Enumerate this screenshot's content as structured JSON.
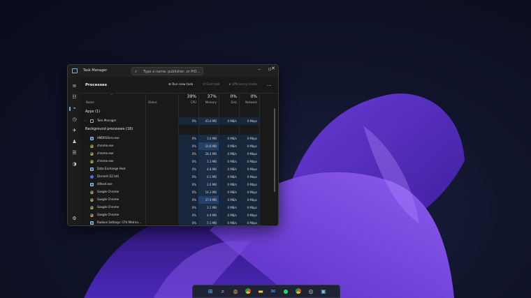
{
  "window": {
    "title": "Task Manager",
    "search_placeholder": "Type a name, publisher, or PID..."
  },
  "sidebar": {
    "items": [
      "hamburger-icon",
      "processes-icon",
      "performance-icon",
      "app-history-icon",
      "startup-icon",
      "users-icon",
      "details-icon",
      "services-icon",
      "settings-icon"
    ]
  },
  "toolbar": {
    "page_title": "Processes",
    "run_new_task": "Run new task",
    "end_task": "End task",
    "efficiency_mode": "Efficiency mode",
    "more": "..."
  },
  "columns": {
    "name": "Name",
    "status": "Status",
    "cpu_pct": "39%",
    "cpu": "CPU",
    "mem_pct": "37%",
    "mem": "Memory",
    "disk_pct": "0%",
    "disk": "Disk",
    "net_pct": "0%",
    "net": "Network"
  },
  "groups": {
    "apps": "Apps (1)",
    "background": "Background processes (18)"
  },
  "apps": [
    {
      "name": "Task Manager",
      "icon": "task-manager-icon",
      "cpu": "0%",
      "mem": "43.4 MB",
      "disk": "0 MB/s",
      "net": "0 Mbps"
    }
  ],
  "background": [
    {
      "name": "AMDRSServ.exe",
      "icon": "app",
      "cpu": "0%",
      "mem": "3.6 MB",
      "disk": "0 MB/s",
      "net": "0 Mbps"
    },
    {
      "name": "chrome.exe",
      "icon": "chrome",
      "cpu": "0%",
      "mem": "10.8 MB",
      "disk": "0 MB/s",
      "net": "0 Mbps"
    },
    {
      "name": "chrome.exe",
      "icon": "chrome",
      "cpu": "0%",
      "mem": "28.4 MB",
      "disk": "0 MB/s",
      "net": "0 Mbps"
    },
    {
      "name": "chrome.exe",
      "icon": "chrome",
      "cpu": "0%",
      "mem": "1.3 MB",
      "disk": "0 MB/s",
      "net": "0 Mbps"
    },
    {
      "name": "Data Exchange Host",
      "icon": "app",
      "cpu": "0%",
      "mem": "4.8 MB",
      "disk": "0 MB/s",
      "net": "0 Mbps"
    },
    {
      "name": "Discord (32 bit)",
      "icon": "discord",
      "cpu": "0%",
      "mem": "0.5 MB",
      "disk": "0 MB/s",
      "net": "0 Mbps"
    },
    {
      "name": "dllhost.exe",
      "icon": "app",
      "cpu": "0%",
      "mem": "2.6 MB",
      "disk": "0 MB/s",
      "net": "0 Mbps"
    },
    {
      "name": "Google Chrome",
      "icon": "chrome",
      "cpu": "0%",
      "mem": "14.3 MB",
      "disk": "0 MB/s",
      "net": "0 Mbps"
    },
    {
      "name": "Google Chrome",
      "icon": "chrome",
      "cpu": "0%",
      "mem": "37.9 MB",
      "disk": "0 MB/s",
      "net": "0 Mbps"
    },
    {
      "name": "Google Chrome",
      "icon": "chrome",
      "cpu": "0%",
      "mem": "3.1 MB",
      "disk": "0 MB/s",
      "net": "0 Mbps"
    },
    {
      "name": "Google Chrome",
      "icon": "chrome",
      "cpu": "0%",
      "mem": "4.9 MB",
      "disk": "0 MB/s",
      "net": "0 Mbps"
    },
    {
      "name": "Radeon Settings: CPU Metrics...",
      "icon": "app",
      "cpu": "0%",
      "mem": "5.1 MB",
      "disk": "0 MB/s",
      "net": "0 Mbps"
    }
  ],
  "taskbar": {
    "icons": [
      "windows-start-icon",
      "search-icon",
      "chat-icon",
      "chrome-icon",
      "file-explorer-icon",
      "mail-icon",
      "spotify-icon",
      "chrome-icon",
      "obs-icon",
      "task-manager-icon"
    ]
  }
}
